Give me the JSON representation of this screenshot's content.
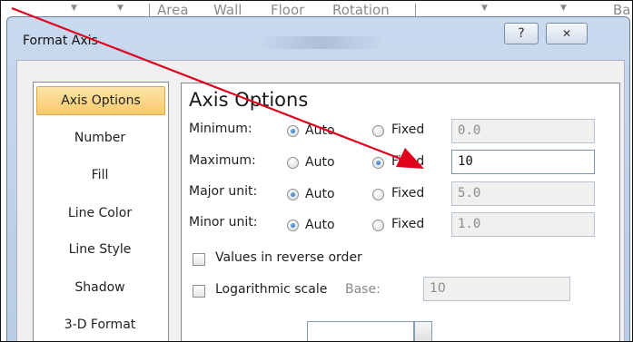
{
  "ribbon": {
    "labels": [
      "Area",
      "Wall",
      "Floor",
      "Rotation",
      "Ba"
    ]
  },
  "dialog": {
    "title": "Format Axis",
    "help_icon": "?",
    "close_icon": "✕"
  },
  "nav": {
    "items": [
      {
        "label": "Axis Options",
        "selected": true
      },
      {
        "label": "Number",
        "selected": false
      },
      {
        "label": "Fill",
        "selected": false
      },
      {
        "label": "Line Color",
        "selected": false
      },
      {
        "label": "Line Style",
        "selected": false
      },
      {
        "label": "Shadow",
        "selected": false
      },
      {
        "label": "3-D Format",
        "selected": false
      }
    ]
  },
  "axis_options": {
    "heading": "Axis Options",
    "rows": [
      {
        "label": "Minimum:",
        "auto": "Auto",
        "fixed": "Fixed",
        "selected": "auto",
        "value": "0.0",
        "enabled": false
      },
      {
        "label": "Maximum:",
        "auto": "Auto",
        "fixed": "Fixed",
        "selected": "fixed",
        "value": "10",
        "enabled": true
      },
      {
        "label": "Major unit:",
        "auto": "Auto",
        "fixed": "Fixed",
        "selected": "auto",
        "value": "5.0",
        "enabled": false
      },
      {
        "label": "Minor unit:",
        "auto": "Auto",
        "fixed": "Fixed",
        "selected": "auto",
        "value": "1.0",
        "enabled": false
      }
    ],
    "reverse_order": {
      "label": "Values in reverse order",
      "checked": false
    },
    "log_scale": {
      "label": "Logarithmic scale",
      "checked": false,
      "base_label": "Base:",
      "base_value": "10"
    }
  },
  "colors": {
    "annotation_arrow": "#e0001b",
    "selection": "#f8c96b",
    "radio_dot": "#1b5fae"
  }
}
